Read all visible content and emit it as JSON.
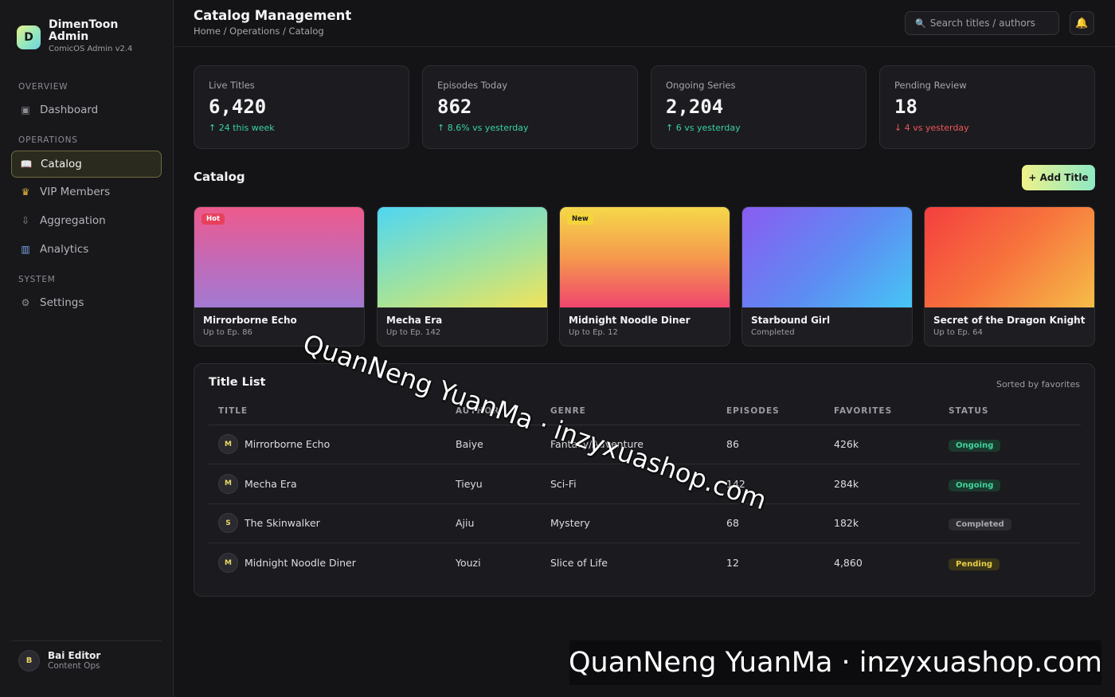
{
  "brand": {
    "logo_letter": "D",
    "name": "DimenToon Admin",
    "subtitle": "ComicOS Admin v2.4"
  },
  "sidebar": {
    "groups": [
      "OVERVIEW",
      "OPERATIONS",
      "SYSTEM"
    ],
    "items": [
      {
        "label": "Dashboard",
        "icon": "dashboard-icon"
      },
      {
        "label": "Catalog",
        "icon": "book-icon",
        "active": true
      },
      {
        "label": "VIP Members",
        "icon": "crown-icon"
      },
      {
        "label": "Aggregation",
        "icon": "download-icon"
      },
      {
        "label": "Analytics",
        "icon": "bar-chart-icon"
      },
      {
        "label": "Settings",
        "icon": "gear-icon"
      }
    ],
    "user": {
      "initial": "B",
      "name": "Bai Editor",
      "role": "Content Ops"
    }
  },
  "header": {
    "title": "Catalog Management",
    "breadcrumb": "Home / Operations / Catalog",
    "search_placeholder": "Search titles / authors"
  },
  "stats": [
    {
      "label": "Live Titles",
      "value": "6,420",
      "delta": "↑ 24 this week",
      "trend": "up"
    },
    {
      "label": "Episodes Today",
      "value": "862",
      "delta": "↑ 8.6% vs yesterday",
      "trend": "up"
    },
    {
      "label": "Ongoing Series",
      "value": "2,204",
      "delta": "↑ 6 vs yesterday",
      "trend": "up"
    },
    {
      "label": "Pending Review",
      "value": "18",
      "delta": "↓ 4 vs yesterday",
      "trend": "down"
    }
  ],
  "catalog": {
    "title": "Catalog",
    "add_button": "+ Add Title",
    "covers": [
      {
        "title": "Mirrorborne Echo",
        "sub": "Up to Ep. 86",
        "badge": "Hot"
      },
      {
        "title": "Mecha Era",
        "sub": "Up to Ep. 142",
        "badge": ""
      },
      {
        "title": "Midnight Noodle Diner",
        "sub": "Up to Ep. 12",
        "badge": "New"
      },
      {
        "title": "Starbound Girl",
        "sub": "Completed",
        "badge": ""
      },
      {
        "title": "Secret of the Dragon Knight",
        "sub": "Up to Ep. 64",
        "badge": ""
      }
    ]
  },
  "table": {
    "title": "Title List",
    "sort_note": "Sorted by favorites",
    "columns": [
      "TITLE",
      "AUTHOR",
      "GENRE",
      "EPISODES",
      "FAVORITES",
      "STATUS"
    ],
    "rows": [
      {
        "initial": "M",
        "title": "Mirrorborne Echo",
        "author": "Baiye",
        "genre": "Fantasy/Adventure",
        "episodes": "86",
        "favorites": "426k",
        "status": "Ongoing"
      },
      {
        "initial": "M",
        "title": "Mecha Era",
        "author": "Tieyu",
        "genre": "Sci-Fi",
        "episodes": "142",
        "favorites": "284k",
        "status": "Ongoing"
      },
      {
        "initial": "S",
        "title": "The Skinwalker",
        "author": "Ajiu",
        "genre": "Mystery",
        "episodes": "68",
        "favorites": "182k",
        "status": "Completed"
      },
      {
        "initial": "M",
        "title": "Midnight Noodle Diner",
        "author": "Youzi",
        "genre": "Slice of Life",
        "episodes": "12",
        "favorites": "4,860",
        "status": "Pending"
      }
    ]
  },
  "watermark": {
    "text": "QuanNeng YuanMa · inzyxuashop.com"
  }
}
